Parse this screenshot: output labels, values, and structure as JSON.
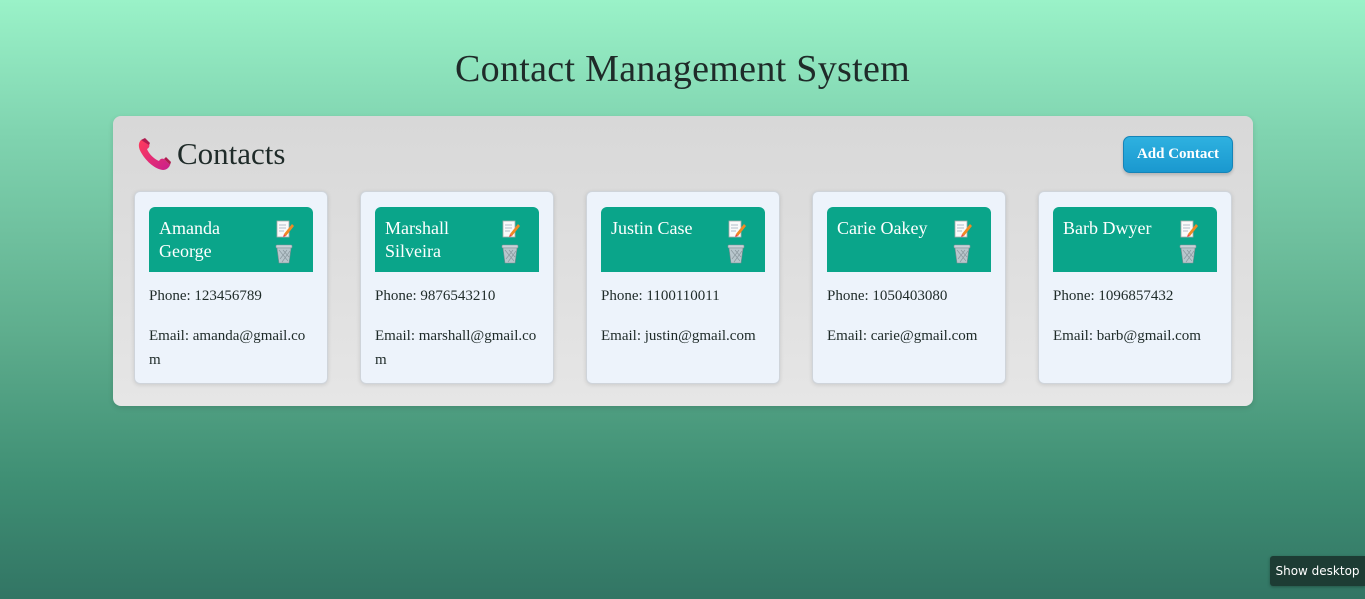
{
  "header": {
    "title": "Contact Management System"
  },
  "panel": {
    "title": "Contacts",
    "title_icon": "phone-icon",
    "add_button_label": "Add Contact"
  },
  "contacts": [
    {
      "name": "Amanda George",
      "phone": "Phone: 123456789",
      "email": "Email: amanda@gmail.com"
    },
    {
      "name": "Marshall Silveira",
      "phone": "Phone: 9876543210",
      "email": "Email: marshall@gmail.com"
    },
    {
      "name": "Justin Case",
      "phone": "Phone: 1100110011",
      "email": "Email: justin@gmail.com"
    },
    {
      "name": "Carie Oakey",
      "phone": "Phone: 1050403080",
      "email": "Email: carie@gmail.com"
    },
    {
      "name": "Barb Dwyer",
      "phone": "Phone: 1096857432",
      "email": "Email: barb@gmail.com"
    }
  ],
  "icons": {
    "edit": "edit-icon",
    "delete": "trash-icon"
  },
  "colors": {
    "card_header": "#0aa58a",
    "add_button": "#1a98cf",
    "card_bg": "#edf3fb",
    "panel_bg": "#dcdcdc"
  },
  "taskbar": {
    "show_desktop_label": "Show desktop"
  }
}
